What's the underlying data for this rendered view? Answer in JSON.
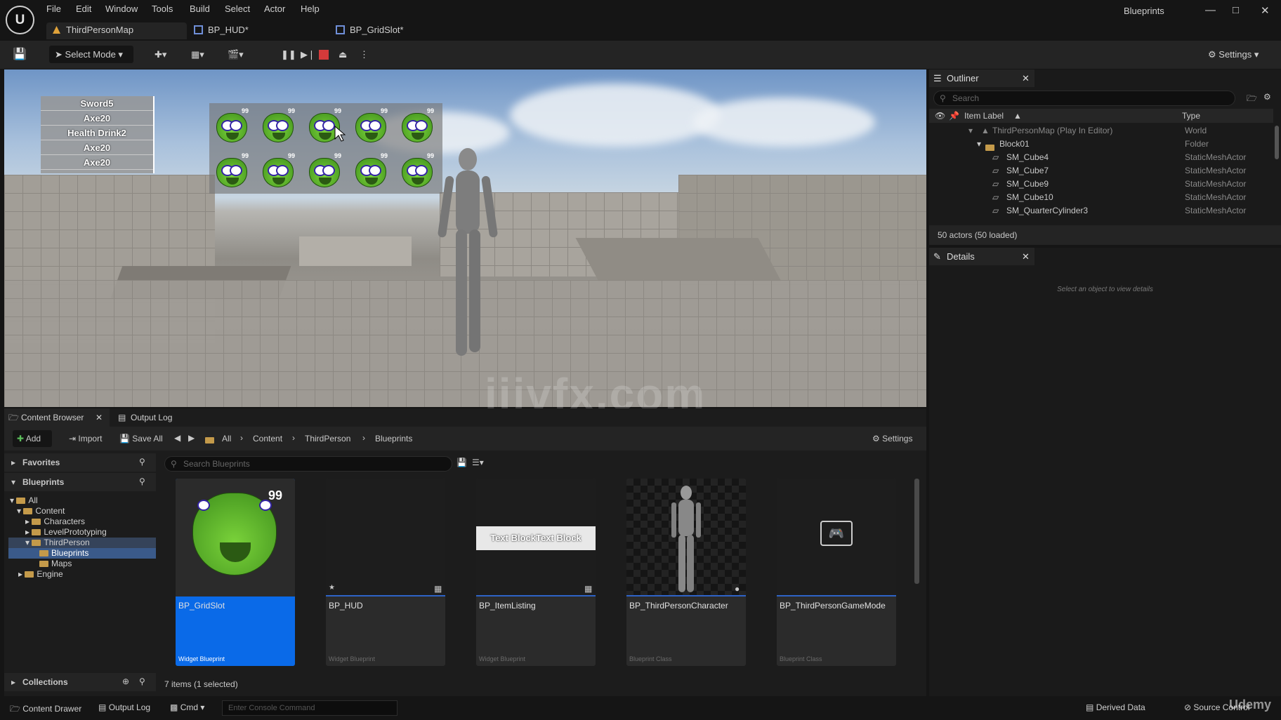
{
  "app": {
    "window_title": "Blueprints",
    "logo": "U"
  },
  "menu": [
    "File",
    "Edit",
    "Window",
    "Tools",
    "Build",
    "Select",
    "Actor",
    "Help"
  ],
  "tabs": [
    {
      "label": "ThirdPersonMap"
    },
    {
      "label": "BP_HUD*"
    },
    {
      "label": "BP_GridSlot*"
    }
  ],
  "toolbar": {
    "select_mode": "Select Mode",
    "settings": "Settings"
  },
  "viewport": {
    "inventory_list": [
      "Sword5",
      "Axe20",
      "Health Drink2",
      "Axe20",
      "Axe20"
    ],
    "slot_count": "99",
    "watermark": "iiivfx.com"
  },
  "outliner": {
    "title": "Outliner",
    "search_placeholder": "Search",
    "col_label": "Item Label",
    "col_type": "Type",
    "rows": [
      {
        "label": "ThirdPersonMap (Play In Editor)",
        "type": "World"
      },
      {
        "label": "Block01",
        "type": "Folder"
      },
      {
        "label": "SM_Cube4",
        "type": "StaticMeshActor"
      },
      {
        "label": "SM_Cube7",
        "type": "StaticMeshActor"
      },
      {
        "label": "SM_Cube9",
        "type": "StaticMeshActor"
      },
      {
        "label": "SM_Cube10",
        "type": "StaticMeshActor"
      },
      {
        "label": "SM_QuarterCylinder3",
        "type": "StaticMeshActor"
      }
    ],
    "footer": "50 actors (50 loaded)"
  },
  "details": {
    "title": "Details",
    "empty": "Select an object to view details"
  },
  "content_browser": {
    "tab": "Content Browser",
    "tab2": "Output Log",
    "add": "Add",
    "import": "Import",
    "save_all": "Save All",
    "breadcrumb": [
      "All",
      "Content",
      "ThirdPerson",
      "Blueprints"
    ],
    "settings": "Settings",
    "favorites": "Favorites",
    "blueprints": "Blueprints",
    "search_placeholder": "Search Blueprints",
    "tree": [
      "All",
      "Content",
      "Characters",
      "LevelPrototyping",
      "ThirdPerson",
      "Blueprints",
      "Maps",
      "Engine"
    ],
    "collections": "Collections",
    "items_count": "7 items (1 selected)",
    "assets": [
      {
        "name": "BP_GridSlot",
        "type": "Widget Blueprint"
      },
      {
        "name": "BP_HUD",
        "type": "Widget Blueprint"
      },
      {
        "name": "BP_ItemListing",
        "type": "Widget Blueprint"
      },
      {
        "name": "BP_ThirdPersonCharacter",
        "type": "Blueprint Class"
      },
      {
        "name": "BP_ThirdPersonGameMode",
        "type": "Blueprint Class"
      }
    ],
    "text_block": "Text BlockText Block"
  },
  "statusbar": {
    "content_drawer": "Content Drawer",
    "output_log": "Output Log",
    "cmd": "Cmd",
    "console_placeholder": "Enter Console Command",
    "derived_data": "Derived Data",
    "source_control": "Source Control",
    "udemy": "Udemy"
  },
  "colors": {
    "accent": "#0a6ae8",
    "stop": "#d43a3a",
    "background": "#151515"
  }
}
